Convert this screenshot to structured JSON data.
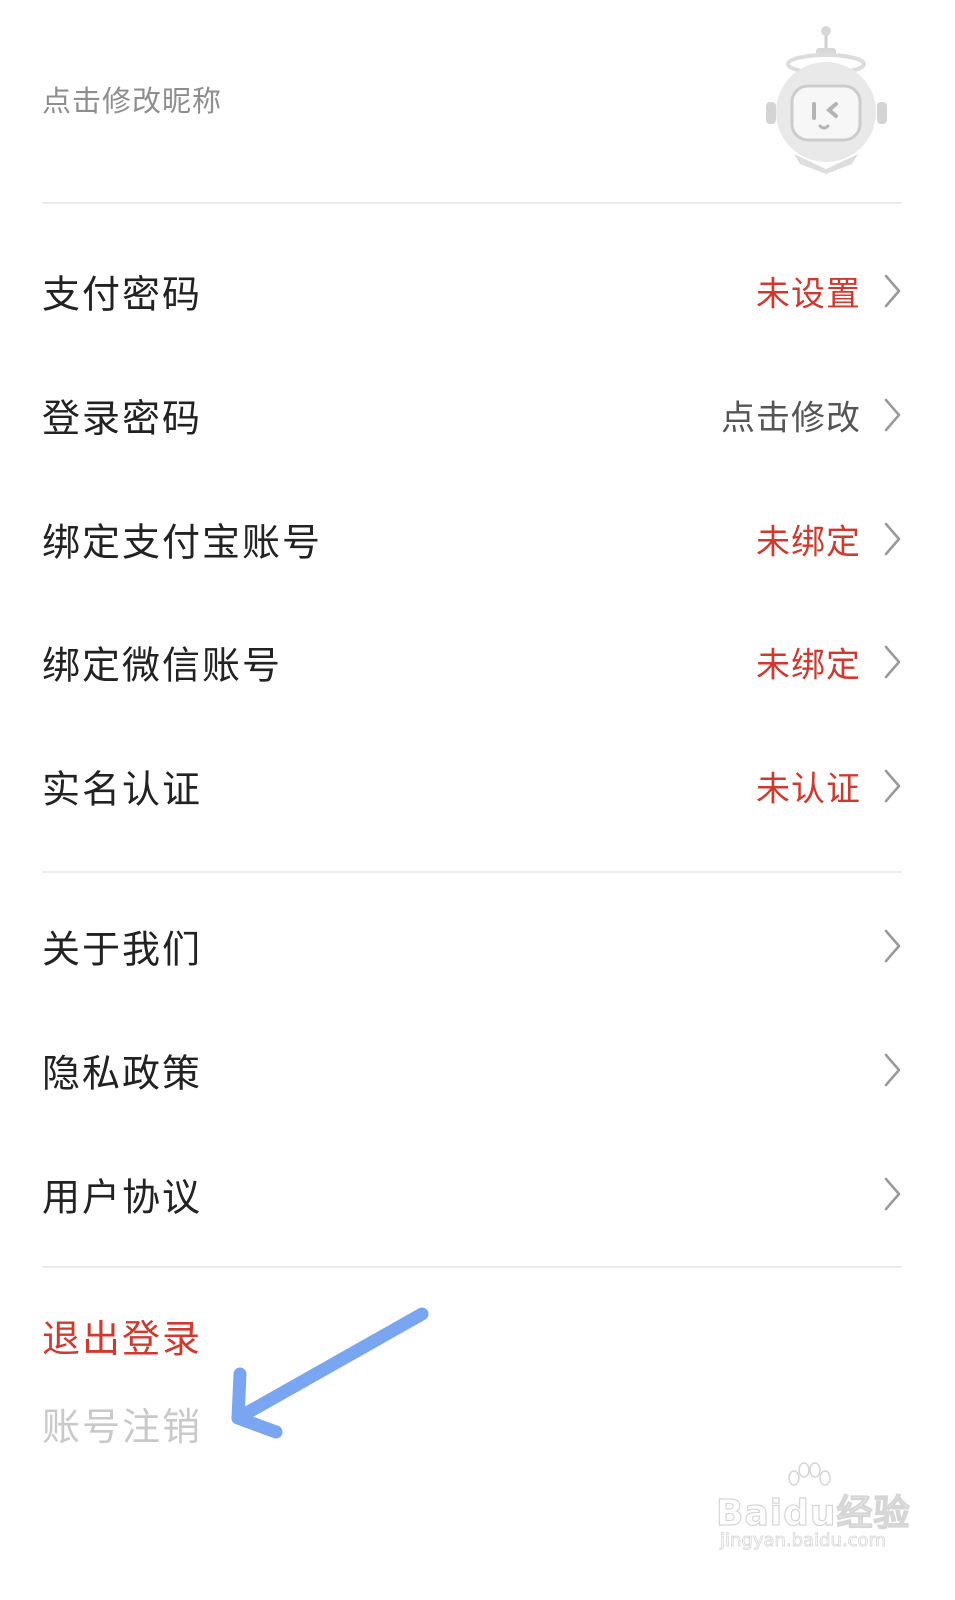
{
  "profile": {
    "nickname_hint": "点击修改昵称"
  },
  "account_section": [
    {
      "label": "支付密码",
      "status": "未设置",
      "status_color": "#d03a2e"
    },
    {
      "label": "登录密码",
      "status": "点击修改",
      "status_color": "#555555"
    },
    {
      "label": "绑定支付宝账号",
      "status": "未绑定",
      "status_color": "#d03a2e"
    },
    {
      "label": "绑定微信账号",
      "status": "未绑定",
      "status_color": "#d03a2e"
    },
    {
      "label": "实名认证",
      "status": "未认证",
      "status_color": "#d03a2e"
    }
  ],
  "info_section": [
    {
      "label": "关于我们"
    },
    {
      "label": "隐私政策"
    },
    {
      "label": "用户协议"
    }
  ],
  "actions": {
    "logout_label": "退出登录",
    "cancel_account_label": "账号注销"
  },
  "annotation": {
    "arrow_color": "#6b9cf0"
  },
  "watermark": {
    "brand": "Baidu经验",
    "url": "jingyan.baidu.com"
  },
  "icons": {
    "avatar": "robot-avatar-icon",
    "chevron": "chevron-right-icon",
    "arrow": "pointer-arrow-icon"
  }
}
